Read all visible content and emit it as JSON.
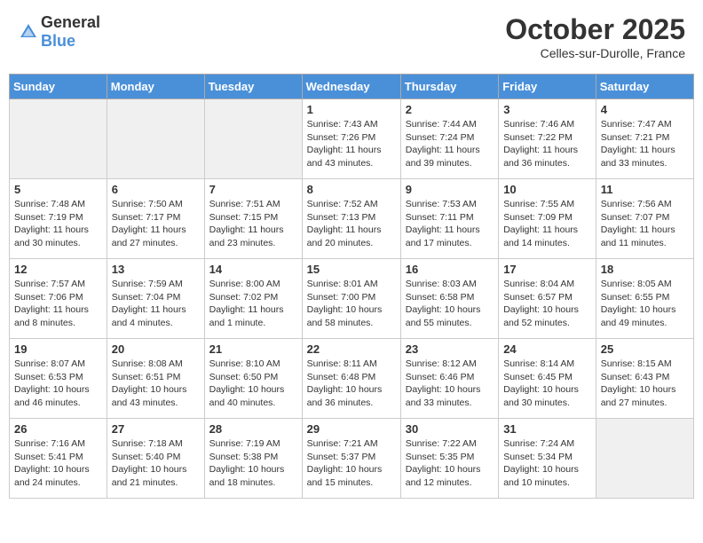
{
  "header": {
    "logo": {
      "general": "General",
      "blue": "Blue"
    },
    "title": "October 2025",
    "subtitle": "Celles-sur-Durolle, France"
  },
  "days_of_week": [
    "Sunday",
    "Monday",
    "Tuesday",
    "Wednesday",
    "Thursday",
    "Friday",
    "Saturday"
  ],
  "weeks": [
    [
      {
        "day": "",
        "info": ""
      },
      {
        "day": "",
        "info": ""
      },
      {
        "day": "",
        "info": ""
      },
      {
        "day": "1",
        "info": "Sunrise: 7:43 AM\nSunset: 7:26 PM\nDaylight: 11 hours and 43 minutes."
      },
      {
        "day": "2",
        "info": "Sunrise: 7:44 AM\nSunset: 7:24 PM\nDaylight: 11 hours and 39 minutes."
      },
      {
        "day": "3",
        "info": "Sunrise: 7:46 AM\nSunset: 7:22 PM\nDaylight: 11 hours and 36 minutes."
      },
      {
        "day": "4",
        "info": "Sunrise: 7:47 AM\nSunset: 7:21 PM\nDaylight: 11 hours and 33 minutes."
      }
    ],
    [
      {
        "day": "5",
        "info": "Sunrise: 7:48 AM\nSunset: 7:19 PM\nDaylight: 11 hours and 30 minutes."
      },
      {
        "day": "6",
        "info": "Sunrise: 7:50 AM\nSunset: 7:17 PM\nDaylight: 11 hours and 27 minutes."
      },
      {
        "day": "7",
        "info": "Sunrise: 7:51 AM\nSunset: 7:15 PM\nDaylight: 11 hours and 23 minutes."
      },
      {
        "day": "8",
        "info": "Sunrise: 7:52 AM\nSunset: 7:13 PM\nDaylight: 11 hours and 20 minutes."
      },
      {
        "day": "9",
        "info": "Sunrise: 7:53 AM\nSunset: 7:11 PM\nDaylight: 11 hours and 17 minutes."
      },
      {
        "day": "10",
        "info": "Sunrise: 7:55 AM\nSunset: 7:09 PM\nDaylight: 11 hours and 14 minutes."
      },
      {
        "day": "11",
        "info": "Sunrise: 7:56 AM\nSunset: 7:07 PM\nDaylight: 11 hours and 11 minutes."
      }
    ],
    [
      {
        "day": "12",
        "info": "Sunrise: 7:57 AM\nSunset: 7:06 PM\nDaylight: 11 hours and 8 minutes."
      },
      {
        "day": "13",
        "info": "Sunrise: 7:59 AM\nSunset: 7:04 PM\nDaylight: 11 hours and 4 minutes."
      },
      {
        "day": "14",
        "info": "Sunrise: 8:00 AM\nSunset: 7:02 PM\nDaylight: 11 hours and 1 minute."
      },
      {
        "day": "15",
        "info": "Sunrise: 8:01 AM\nSunset: 7:00 PM\nDaylight: 10 hours and 58 minutes."
      },
      {
        "day": "16",
        "info": "Sunrise: 8:03 AM\nSunset: 6:58 PM\nDaylight: 10 hours and 55 minutes."
      },
      {
        "day": "17",
        "info": "Sunrise: 8:04 AM\nSunset: 6:57 PM\nDaylight: 10 hours and 52 minutes."
      },
      {
        "day": "18",
        "info": "Sunrise: 8:05 AM\nSunset: 6:55 PM\nDaylight: 10 hours and 49 minutes."
      }
    ],
    [
      {
        "day": "19",
        "info": "Sunrise: 8:07 AM\nSunset: 6:53 PM\nDaylight: 10 hours and 46 minutes."
      },
      {
        "day": "20",
        "info": "Sunrise: 8:08 AM\nSunset: 6:51 PM\nDaylight: 10 hours and 43 minutes."
      },
      {
        "day": "21",
        "info": "Sunrise: 8:10 AM\nSunset: 6:50 PM\nDaylight: 10 hours and 40 minutes."
      },
      {
        "day": "22",
        "info": "Sunrise: 8:11 AM\nSunset: 6:48 PM\nDaylight: 10 hours and 36 minutes."
      },
      {
        "day": "23",
        "info": "Sunrise: 8:12 AM\nSunset: 6:46 PM\nDaylight: 10 hours and 33 minutes."
      },
      {
        "day": "24",
        "info": "Sunrise: 8:14 AM\nSunset: 6:45 PM\nDaylight: 10 hours and 30 minutes."
      },
      {
        "day": "25",
        "info": "Sunrise: 8:15 AM\nSunset: 6:43 PM\nDaylight: 10 hours and 27 minutes."
      }
    ],
    [
      {
        "day": "26",
        "info": "Sunrise: 7:16 AM\nSunset: 5:41 PM\nDaylight: 10 hours and 24 minutes."
      },
      {
        "day": "27",
        "info": "Sunrise: 7:18 AM\nSunset: 5:40 PM\nDaylight: 10 hours and 21 minutes."
      },
      {
        "day": "28",
        "info": "Sunrise: 7:19 AM\nSunset: 5:38 PM\nDaylight: 10 hours and 18 minutes."
      },
      {
        "day": "29",
        "info": "Sunrise: 7:21 AM\nSunset: 5:37 PM\nDaylight: 10 hours and 15 minutes."
      },
      {
        "day": "30",
        "info": "Sunrise: 7:22 AM\nSunset: 5:35 PM\nDaylight: 10 hours and 12 minutes."
      },
      {
        "day": "31",
        "info": "Sunrise: 7:24 AM\nSunset: 5:34 PM\nDaylight: 10 hours and 10 minutes."
      },
      {
        "day": "",
        "info": ""
      }
    ]
  ]
}
